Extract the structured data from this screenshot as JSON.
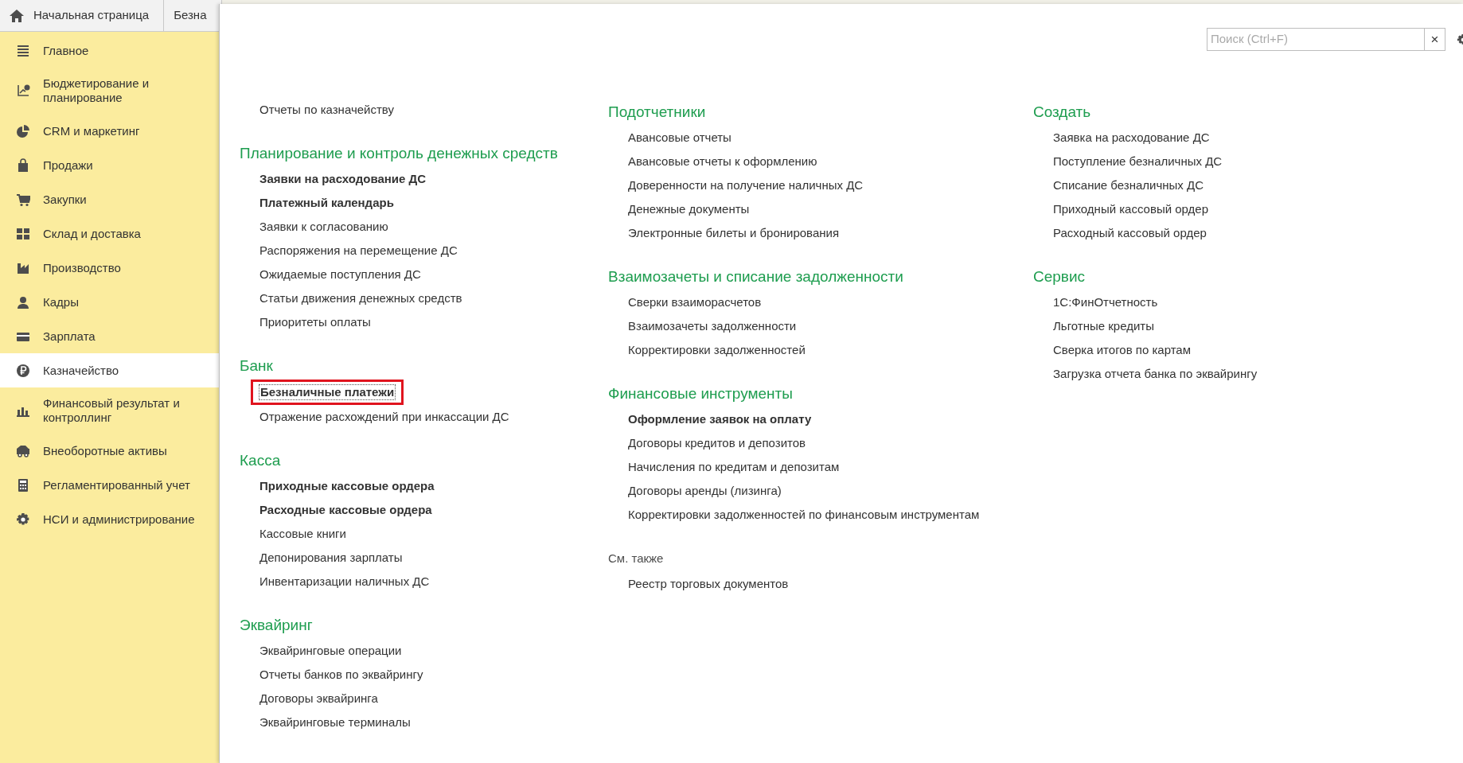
{
  "tabs": [
    {
      "label": "Начальная страница",
      "kind": "home",
      "selected": false
    },
    {
      "label": "Безна",
      "kind": "doc",
      "selected": false
    }
  ],
  "sidebar": {
    "items": [
      {
        "label": "Главное",
        "selected": false
      },
      {
        "label": "Бюджетирование и планирование",
        "selected": false
      },
      {
        "label": "CRM и маркетинг",
        "selected": false
      },
      {
        "label": "Продажи",
        "selected": false
      },
      {
        "label": "Закупки",
        "selected": false
      },
      {
        "label": "Склад и доставка",
        "selected": false
      },
      {
        "label": "Производство",
        "selected": false
      },
      {
        "label": "Кадры",
        "selected": false
      },
      {
        "label": "Зарплата",
        "selected": false
      },
      {
        "label": "Казначейство",
        "selected": true
      },
      {
        "label": "Финансовый результат и контроллинг",
        "selected": false
      },
      {
        "label": "Внеоборотные активы",
        "selected": false
      },
      {
        "label": "Регламентированный учет",
        "selected": false
      },
      {
        "label": "НСИ и администрирование",
        "selected": false
      }
    ]
  },
  "search": {
    "placeholder": "Поиск (Ctrl+F)",
    "clear": "×"
  },
  "columns": [
    {
      "groups": [
        {
          "items": [
            {
              "label": "Отчеты по казначейству",
              "bold": false,
              "highlighted": false
            }
          ]
        },
        {
          "title": "Планирование и контроль денежных средств",
          "kind": "section",
          "items": [
            {
              "label": "Заявки на расходование ДС",
              "bold": true,
              "highlighted": false
            },
            {
              "label": "Платежный календарь",
              "bold": true,
              "highlighted": false
            },
            {
              "label": "Заявки к согласованию",
              "bold": false,
              "highlighted": false
            },
            {
              "label": "Распоряжения на перемещение ДС",
              "bold": false,
              "highlighted": false
            },
            {
              "label": "Ожидаемые поступления ДС",
              "bold": false,
              "highlighted": false
            },
            {
              "label": "Статьи движения денежных средств",
              "bold": false,
              "highlighted": false
            },
            {
              "label": "Приоритеты оплаты",
              "bold": false,
              "highlighted": false
            }
          ]
        },
        {
          "title": "Банк",
          "kind": "section",
          "items": [
            {
              "label": "Безналичные платежи",
              "bold": true,
              "highlighted": true
            },
            {
              "label": "Отражение расхождений при инкассации ДС",
              "bold": false,
              "highlighted": false
            }
          ]
        },
        {
          "title": "Касса",
          "kind": "section",
          "items": [
            {
              "label": "Приходные кассовые ордера",
              "bold": true,
              "highlighted": false
            },
            {
              "label": "Расходные кассовые ордера",
              "bold": true,
              "highlighted": false
            },
            {
              "label": "Кассовые книги",
              "bold": false,
              "highlighted": false
            },
            {
              "label": "Депонирования зарплаты",
              "bold": false,
              "highlighted": false
            },
            {
              "label": "Инвентаризации наличных ДС",
              "bold": false,
              "highlighted": false
            }
          ]
        },
        {
          "title": "Эквайринг",
          "kind": "section",
          "items": [
            {
              "label": "Эквайринговые операции",
              "bold": false,
              "highlighted": false
            },
            {
              "label": "Отчеты банков по эквайрингу",
              "bold": false,
              "highlighted": false
            },
            {
              "label": "Договоры эквайринга",
              "bold": false,
              "highlighted": false
            },
            {
              "label": "Эквайринговые терминалы",
              "bold": false,
              "highlighted": false
            }
          ]
        }
      ]
    },
    {
      "groups": [
        {
          "title": "Подотчетники",
          "kind": "section",
          "items": [
            {
              "label": "Авансовые отчеты",
              "bold": false,
              "highlighted": false
            },
            {
              "label": "Авансовые отчеты к оформлению",
              "bold": false,
              "highlighted": false
            },
            {
              "label": "Доверенности на получение наличных ДС",
              "bold": false,
              "highlighted": false
            },
            {
              "label": "Денежные документы",
              "bold": false,
              "highlighted": false
            },
            {
              "label": "Электронные билеты и бронирования",
              "bold": false,
              "highlighted": false
            }
          ]
        },
        {
          "title": "Взаимозачеты и списание задолженности",
          "kind": "section",
          "items": [
            {
              "label": "Сверки взаиморасчетов",
              "bold": false,
              "highlighted": false
            },
            {
              "label": "Взаимозачеты задолженности",
              "bold": false,
              "highlighted": false
            },
            {
              "label": "Корректировки задолженностей",
              "bold": false,
              "highlighted": false
            }
          ]
        },
        {
          "title": "Финансовые инструменты",
          "kind": "section",
          "items": [
            {
              "label": "Оформление заявок на оплату",
              "bold": true,
              "highlighted": false
            },
            {
              "label": "Договоры кредитов и депозитов",
              "bold": false,
              "highlighted": false
            },
            {
              "label": "Начисления по кредитам и депозитам",
              "bold": false,
              "highlighted": false
            },
            {
              "label": "Договоры аренды (лизинга)",
              "bold": false,
              "highlighted": false
            },
            {
              "label": "Корректировки задолженностей по финансовым инструментам",
              "bold": false,
              "highlighted": false
            }
          ]
        },
        {
          "title": "См. также",
          "kind": "see_also",
          "items": [
            {
              "label": "Реестр торговых документов",
              "bold": false,
              "highlighted": false
            }
          ]
        }
      ]
    },
    {
      "groups": [
        {
          "title": "Создать",
          "kind": "section",
          "items": [
            {
              "label": "Заявка на расходование ДС",
              "bold": false,
              "highlighted": false
            },
            {
              "label": "Поступление безналичных ДС",
              "bold": false,
              "highlighted": false
            },
            {
              "label": "Списание безналичных ДС",
              "bold": false,
              "highlighted": false
            },
            {
              "label": "Приходный кассовый ордер",
              "bold": false,
              "highlighted": false
            },
            {
              "label": "Расходный кассовый ордер",
              "bold": false,
              "highlighted": false
            }
          ]
        },
        {
          "title": "Сервис",
          "kind": "section",
          "items": [
            {
              "label": "1С:ФинОтчетность",
              "bold": false,
              "highlighted": false
            },
            {
              "label": "Льготные кредиты",
              "bold": false,
              "highlighted": false
            },
            {
              "label": "Сверка итогов по картам",
              "bold": false,
              "highlighted": false
            },
            {
              "label": "Загрузка отчета банка по эквайрингу",
              "bold": false,
              "highlighted": false
            }
          ]
        }
      ]
    }
  ]
}
